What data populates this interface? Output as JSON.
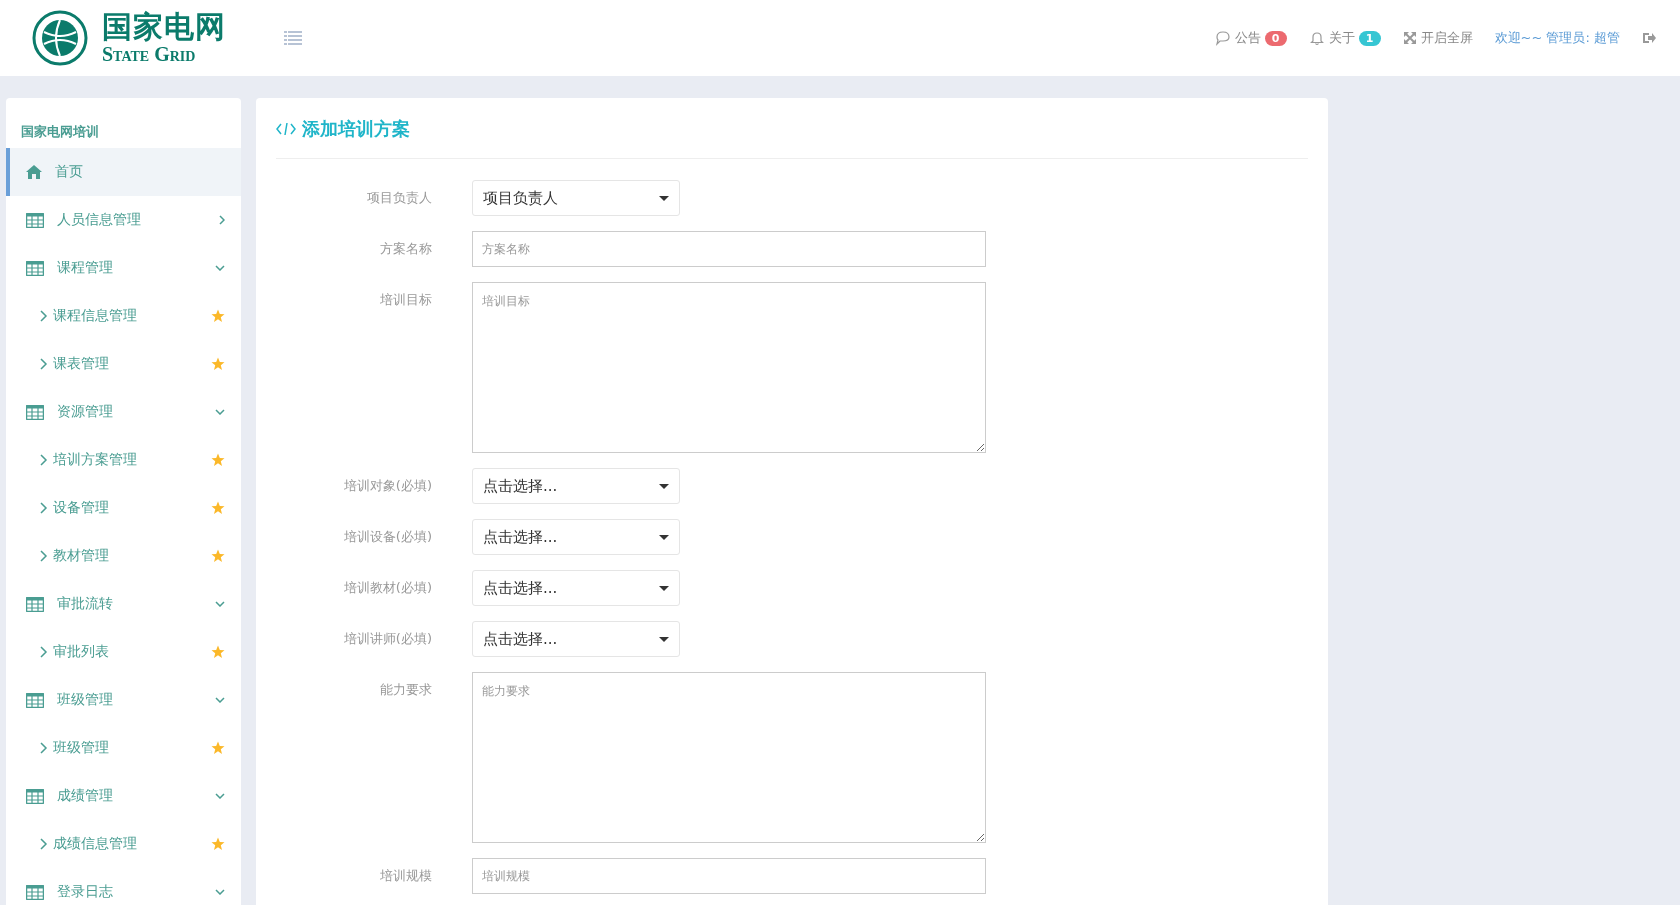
{
  "header": {
    "logo": {
      "name_cn": "国家电网",
      "name_en": "State Grid"
    },
    "actions": [
      {
        "kind": "notice",
        "label": "公告",
        "badge": "0",
        "color": "#ec6a6f"
      },
      {
        "kind": "bell",
        "label": "关于",
        "badge": "1",
        "color": "#36c6d3"
      },
      {
        "kind": "fullscreen",
        "label": "开启全屏"
      },
      {
        "kind": "user",
        "label": "欢迎~~ 管理员: 超管"
      },
      {
        "kind": "logout"
      }
    ]
  },
  "sidebar": {
    "title": "国家电网培训",
    "items": [
      {
        "kind": "home",
        "label": "首页",
        "selected": true
      },
      {
        "kind": "group",
        "label": "人员信息管理",
        "selected": false,
        "expanded": false
      },
      {
        "kind": "group",
        "label": "课程管理",
        "selected": false,
        "expanded": true,
        "children": [
          {
            "label": "课程信息管理"
          },
          {
            "label": "课表管理"
          }
        ]
      },
      {
        "kind": "group",
        "label": "资源管理",
        "selected": false,
        "expanded": true,
        "children": [
          {
            "label": "培训方案管理"
          },
          {
            "label": "设备管理"
          },
          {
            "label": "教材管理"
          }
        ]
      },
      {
        "kind": "group",
        "label": "审批流转",
        "selected": false,
        "expanded": true,
        "children": [
          {
            "label": "审批列表"
          }
        ]
      },
      {
        "kind": "group",
        "label": "班级管理",
        "selected": false,
        "expanded": true,
        "children": [
          {
            "label": "班级管理"
          }
        ]
      },
      {
        "kind": "group",
        "label": "成绩管理",
        "selected": false,
        "expanded": true,
        "children": [
          {
            "label": "成绩信息管理"
          }
        ]
      },
      {
        "kind": "group",
        "label": "登录日志",
        "selected": false,
        "expanded": true
      }
    ]
  },
  "form": {
    "title": "添加培训方案",
    "fields": [
      {
        "kind": "select",
        "label": "项目负责人",
        "value": "项目负责人"
      },
      {
        "kind": "input",
        "label": "方案名称",
        "placeholder": "方案名称"
      },
      {
        "kind": "textarea",
        "label": "培训目标",
        "placeholder": "培训目标"
      },
      {
        "kind": "select",
        "label": "培训对象(必填)",
        "value": "点击选择..."
      },
      {
        "kind": "select",
        "label": "培训设备(必填)",
        "value": "点击选择..."
      },
      {
        "kind": "select",
        "label": "培训教材(必填)",
        "value": "点击选择..."
      },
      {
        "kind": "select",
        "label": "培训讲师(必填)",
        "value": "点击选择..."
      },
      {
        "kind": "textarea",
        "label": "能力要求",
        "placeholder": "能力要求"
      },
      {
        "kind": "input",
        "label": "培训规模",
        "placeholder": "培训规模"
      }
    ]
  }
}
